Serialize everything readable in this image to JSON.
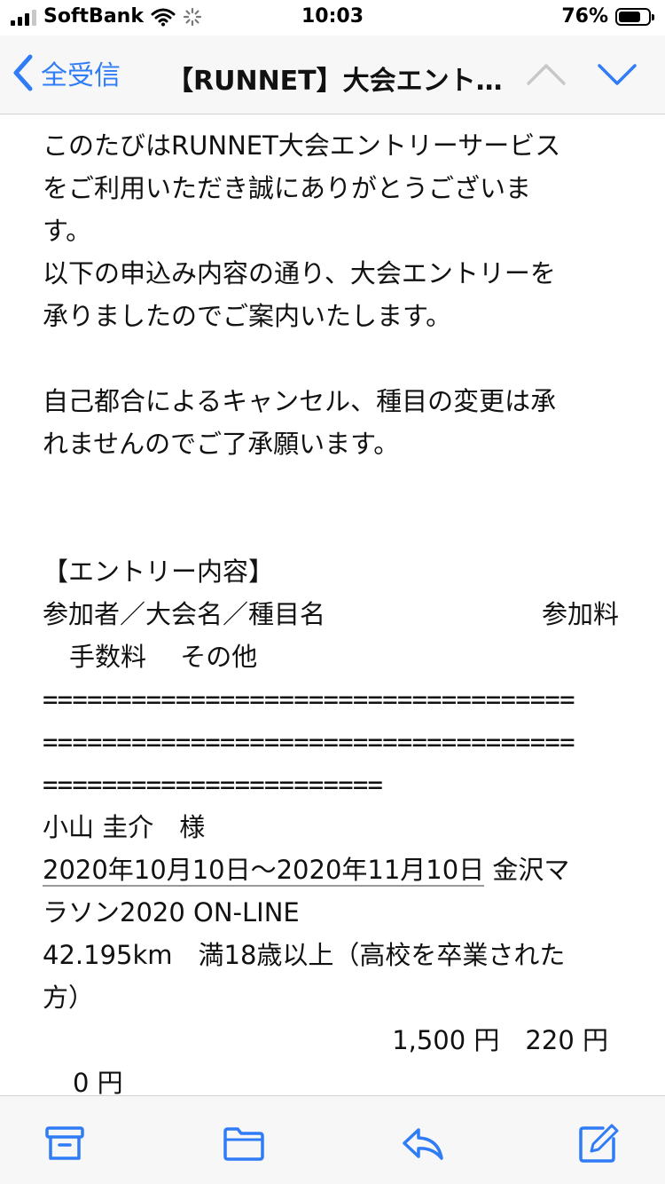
{
  "status_bar": {
    "carrier": "SoftBank",
    "time": "10:03",
    "battery_percent": "76%",
    "battery_level": 0.76
  },
  "nav": {
    "back_label": "全受信",
    "title": "【RUNNET】大会エント…",
    "up_icon": "chevron-up-icon",
    "down_icon": "chevron-down-icon"
  },
  "email": {
    "intro_lines": [
      "このたびはRUNNET大会エントリーサービス",
      "をご利用いただき誠にありがとうございま",
      "す。",
      "以下の申込み内容の通り、大会エントリーを",
      "承りましたのでご案内いたします。"
    ],
    "notice_lines": [
      "自己都合によるキャンセル、種目の変更は承",
      "れませんのでご了承願います。"
    ],
    "entry_heading": "【エントリー内容】",
    "table_header_left": "参加者／大会名／種目名",
    "table_header_right": "参加料",
    "table_header_second": "手数料　 その他",
    "separator_1": "====================================",
    "separator_2": "====================================",
    "separator_3": "=======================",
    "participant": "小山 圭介　様",
    "event_date": "2020年10月10日〜2020年11月10日",
    "event_name_part1": " 金沢マ",
    "event_name_part2": "ラソン2020 ON-LINE",
    "category_line1": "42.195km　満18歳以上（高校を卒業された",
    "category_line2": "方）",
    "fees": "1,500 円　220 円",
    "other_fee": "0 円"
  },
  "toolbar": {
    "archive_icon": "archive-icon",
    "folder_icon": "folder-icon",
    "reply_icon": "reply-icon",
    "compose_icon": "compose-icon"
  },
  "colors": {
    "accent": "#2f7cf6",
    "disabled": "#c8c8c8",
    "bar_background": "#f7f7f7"
  }
}
